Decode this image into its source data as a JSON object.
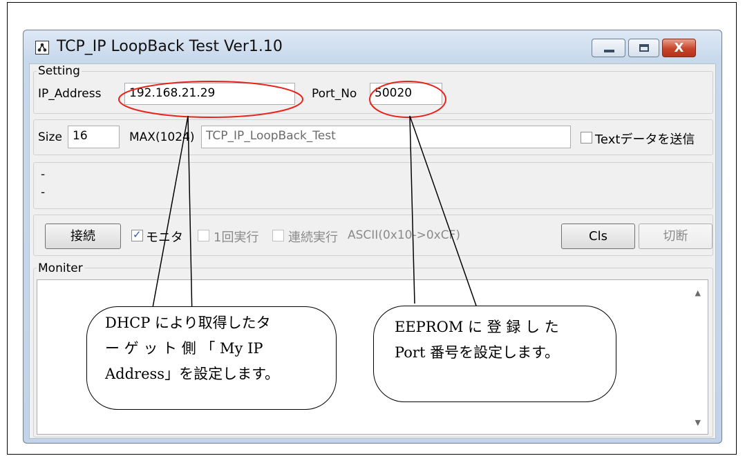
{
  "window": {
    "title": "TCP_IP LoopBack Test Ver1.10",
    "close_glyph": "X"
  },
  "setting": {
    "group_label": "Setting",
    "ip_label": "IP_Address",
    "ip_value": "192.168.21.29",
    "port_label": "Port_No",
    "port_value": "50020"
  },
  "data_row": {
    "size_label": "Size",
    "size_value": "16",
    "max_label": "MAX(1024)",
    "text_value": "TCP_IP_LoopBack_Test",
    "send_text_label": "Textデータを送信",
    "send_text_checked": false
  },
  "status": {
    "line1": "-",
    "line2": "-"
  },
  "controls": {
    "connect_label": "接続",
    "monitor_label": "モニタ",
    "monitor_checked": true,
    "once_label": "1回実行",
    "once_checked": false,
    "continuous_label": "連続実行",
    "continuous_checked": false,
    "ascii_label": "ASCII(0x10->0xCF)",
    "cls_label": "Cls",
    "disconnect_label": "切断"
  },
  "monitor": {
    "group_label": "Moniter",
    "scroll_up_icon": "▲",
    "scroll_down_icon": "▼"
  },
  "annotations": {
    "left_lines": [
      "DHCP により取得したタ",
      "ー ゲ ッ ト 側 「 My IP",
      "Address」を設定します。"
    ],
    "right_lines": [
      "EEPROM に 登 録 し た",
      "Port 番号を設定します。"
    ]
  },
  "colors": {
    "highlight": "#e8231a",
    "client_bg": "#f0f0f0"
  }
}
